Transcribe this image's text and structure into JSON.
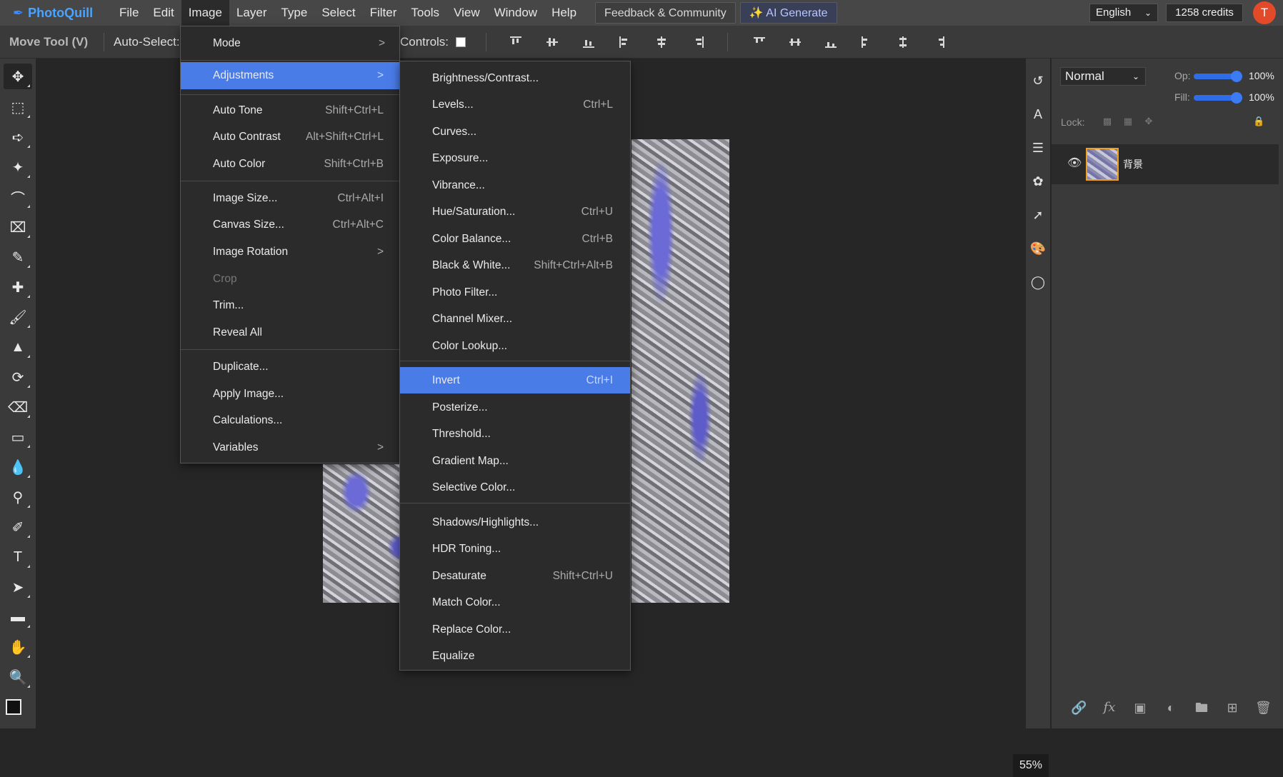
{
  "app": {
    "name": "PhotoQuill"
  },
  "menubar": {
    "items": [
      "File",
      "Edit",
      "Image",
      "Layer",
      "Type",
      "Select",
      "Filter",
      "Tools",
      "View",
      "Window",
      "Help"
    ],
    "active": "Image",
    "feedback": "Feedback & Community",
    "ai_generate": "AI Generate",
    "language": "English",
    "credits": "1258 credits",
    "avatar_initial": "T"
  },
  "options_bar": {
    "tool_name": "Move Tool (V)",
    "auto_select": "Auto-Select:",
    "controls": "Controls:"
  },
  "image_menu": {
    "items": [
      {
        "label": "Mode",
        "shortcut": ">"
      },
      {
        "label": "Adjustments",
        "shortcut": ">"
      },
      {
        "label": "Auto Tone",
        "shortcut": "Shift+Ctrl+L"
      },
      {
        "label": "Auto Contrast",
        "shortcut": "Alt+Shift+Ctrl+L"
      },
      {
        "label": "Auto Color",
        "shortcut": "Shift+Ctrl+B"
      },
      {
        "label": "Image Size...",
        "shortcut": "Ctrl+Alt+I"
      },
      {
        "label": "Canvas Size...",
        "shortcut": "Ctrl+Alt+C"
      },
      {
        "label": "Image Rotation",
        "shortcut": ">"
      },
      {
        "label": "Crop",
        "shortcut": ""
      },
      {
        "label": "Trim...",
        "shortcut": ""
      },
      {
        "label": "Reveal All",
        "shortcut": ""
      },
      {
        "label": "Duplicate...",
        "shortcut": ""
      },
      {
        "label": "Apply Image...",
        "shortcut": ""
      },
      {
        "label": "Calculations...",
        "shortcut": ""
      },
      {
        "label": "Variables",
        "shortcut": ">"
      }
    ]
  },
  "adjustments_menu": {
    "items": [
      {
        "label": "Brightness/Contrast...",
        "shortcut": ""
      },
      {
        "label": "Levels...",
        "shortcut": "Ctrl+L"
      },
      {
        "label": "Curves...",
        "shortcut": ""
      },
      {
        "label": "Exposure...",
        "shortcut": ""
      },
      {
        "label": "Vibrance...",
        "shortcut": ""
      },
      {
        "label": "Hue/Saturation...",
        "shortcut": "Ctrl+U"
      },
      {
        "label": "Color Balance...",
        "shortcut": "Ctrl+B"
      },
      {
        "label": "Black & White...",
        "shortcut": "Shift+Ctrl+Alt+B"
      },
      {
        "label": "Photo Filter...",
        "shortcut": ""
      },
      {
        "label": "Channel Mixer...",
        "shortcut": ""
      },
      {
        "label": "Color Lookup...",
        "shortcut": ""
      },
      {
        "label": "Invert",
        "shortcut": "Ctrl+I"
      },
      {
        "label": "Posterize...",
        "shortcut": ""
      },
      {
        "label": "Threshold...",
        "shortcut": ""
      },
      {
        "label": "Gradient Map...",
        "shortcut": ""
      },
      {
        "label": "Selective Color...",
        "shortcut": ""
      },
      {
        "label": "Shadows/Highlights...",
        "shortcut": ""
      },
      {
        "label": "HDR Toning...",
        "shortcut": ""
      },
      {
        "label": "Desaturate",
        "shortcut": "Shift+Ctrl+U"
      },
      {
        "label": "Match Color...",
        "shortcut": ""
      },
      {
        "label": "Replace Color...",
        "shortcut": ""
      },
      {
        "label": "Equalize",
        "shortcut": ""
      }
    ]
  },
  "layers_panel": {
    "blend_mode": "Normal",
    "opacity_label": "Op:",
    "opacity_value": "100%",
    "opacity_fraction": 1.0,
    "fill_label": "Fill:",
    "fill_value": "100%",
    "fill_fraction": 1.0,
    "lock_label": "Lock:",
    "layer_name": "背景"
  },
  "canvas": {
    "zoom": "55%"
  },
  "colors": {
    "accent": "#4a7ce8",
    "logo": "#4aa3ff",
    "avatar": "#e24a2a"
  }
}
